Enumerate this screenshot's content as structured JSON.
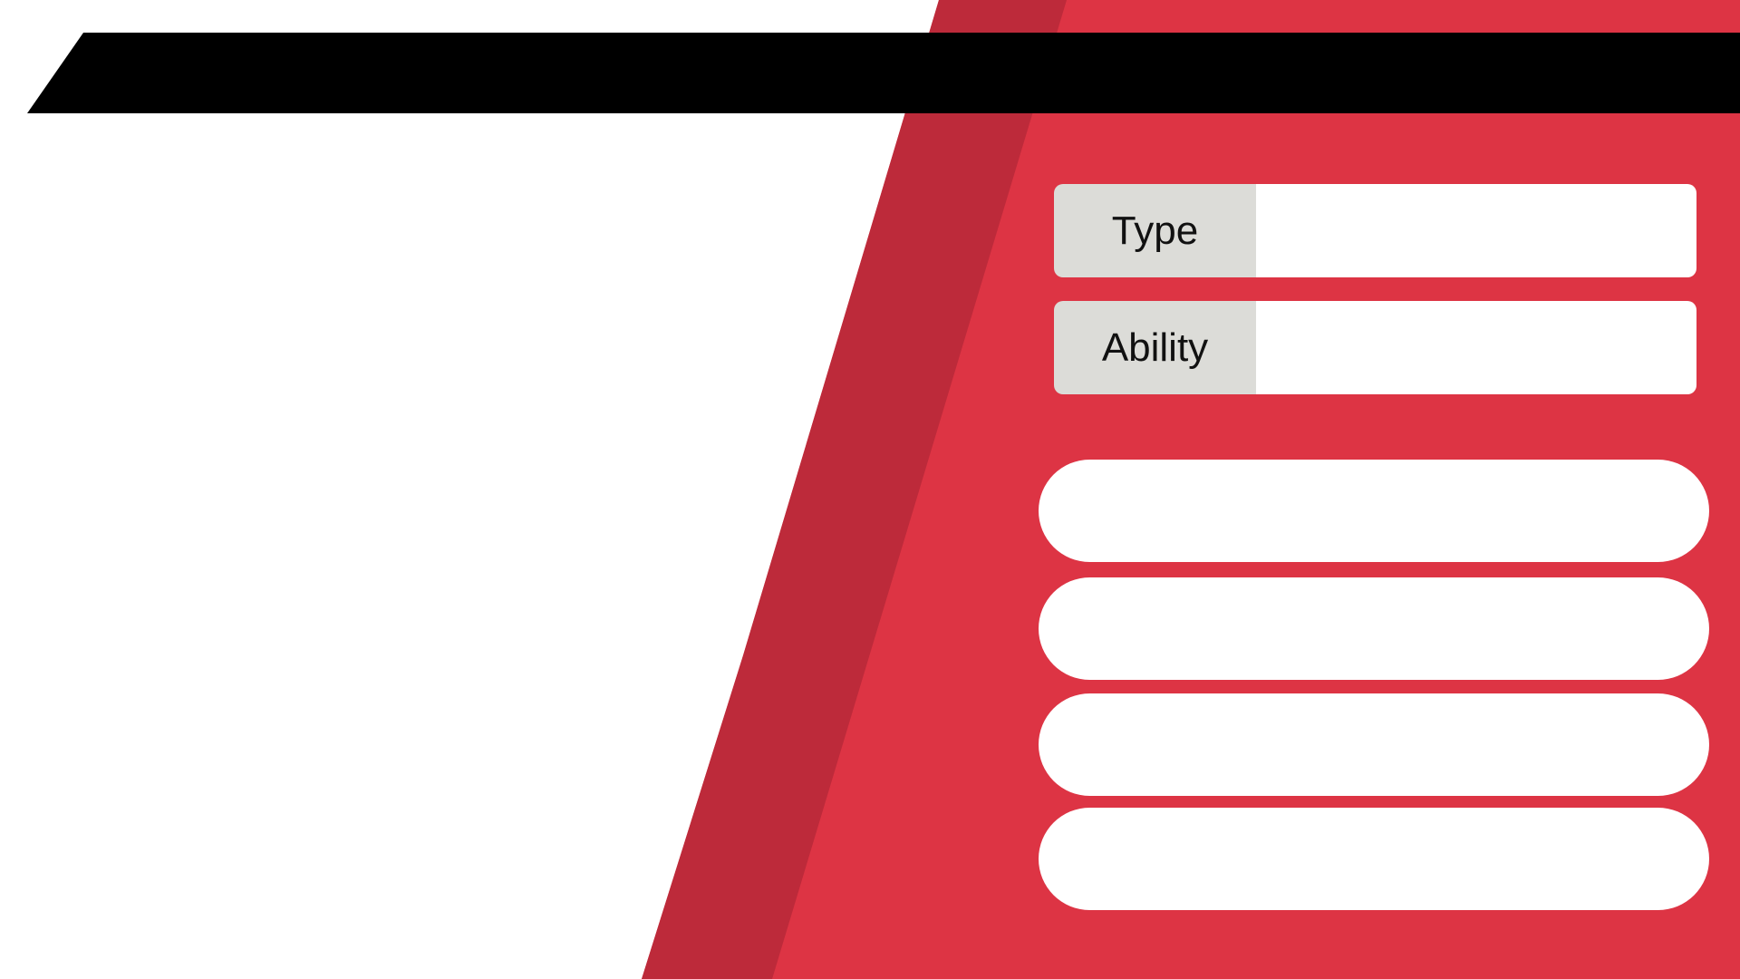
{
  "colors": {
    "panel_red": "#dd3444",
    "stripe_dark_red": "#bd2a3a",
    "banner_black": "#000000",
    "label_gray": "#dcdcd8",
    "slot_white": "#ffffff"
  },
  "banner": {
    "title": ""
  },
  "info": {
    "type_label": "Type",
    "type_value": "",
    "ability_label": "Ability",
    "ability_value": ""
  },
  "moves": [
    "",
    "",
    "",
    ""
  ]
}
